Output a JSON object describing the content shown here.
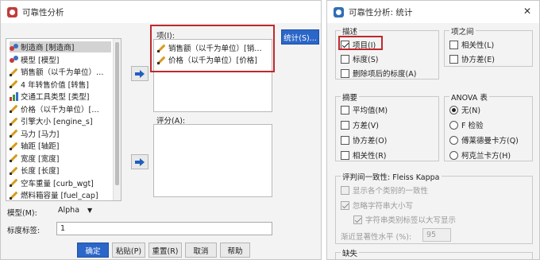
{
  "left_dialog": {
    "title": "可靠性分析",
    "variables": [
      {
        "label": "制造商 [制造商]",
        "icon": "nominal-icon"
      },
      {
        "label": "模型 [模型]",
        "icon": "nominal-icon"
      },
      {
        "label": "销售额（以千为单位）…",
        "icon": "scale-icon"
      },
      {
        "label": "4 年转售价值 [转售]",
        "icon": "scale-icon"
      },
      {
        "label": "交通工具类型 [类型]",
        "icon": "ordinal-icon"
      },
      {
        "label": "价格（以千为单位）[…",
        "icon": "scale-icon"
      },
      {
        "label": "引擎大小 [engine_s]",
        "icon": "scale-icon"
      },
      {
        "label": "马力 [马力]",
        "icon": "scale-icon"
      },
      {
        "label": "轴距 [轴距]",
        "icon": "scale-icon"
      },
      {
        "label": "宽度 [宽度]",
        "icon": "scale-icon"
      },
      {
        "label": "长度 [长度]",
        "icon": "scale-icon"
      },
      {
        "label": "空车重量 [curb_wgt]",
        "icon": "scale-icon"
      },
      {
        "label": "燃料箱容量 [fuel_cap]",
        "icon": "scale-icon"
      }
    ],
    "items_label": "项(I):",
    "items": [
      "销售额（以千为单位）[销…",
      "价格（以千为单位）[价格]"
    ],
    "raters_label": "评分(A):",
    "stats_button": "统计(S)...",
    "model_label": "模型(M):",
    "model_value": "Alpha",
    "scale_label_label": "标度标签:",
    "scale_label_value": "1",
    "buttons": {
      "ok": "确定",
      "paste": "粘贴(P)",
      "reset": "重置(R)",
      "cancel": "取消",
      "help": "帮助"
    }
  },
  "right_dialog": {
    "title": "可靠性分析: 统计",
    "descriptives": {
      "title": "描述",
      "options": [
        {
          "label": "项目(I)",
          "checked": true
        },
        {
          "label": "标度(S)",
          "checked": false
        },
        {
          "label": "删除项后的标度(A)",
          "checked": false
        }
      ]
    },
    "inter_item": {
      "title": "项之间",
      "options": [
        {
          "label": "相关性(L)",
          "checked": false
        },
        {
          "label": "协方差(E)",
          "checked": false
        }
      ]
    },
    "summaries": {
      "title": "摘要",
      "options": [
        {
          "label": "平均值(M)",
          "checked": false
        },
        {
          "label": "方差(V)",
          "checked": false
        },
        {
          "label": "协方差(O)",
          "checked": false
        },
        {
          "label": "相关性(R)",
          "checked": false
        }
      ]
    },
    "anova": {
      "title": "ANOVA 表",
      "options": [
        {
          "label": "无(N)",
          "selected": true
        },
        {
          "label": "F 检验",
          "selected": false
        },
        {
          "label": "傅莱德曼卡方(Q)",
          "selected": false
        },
        {
          "label": "柯克兰卡方(H)",
          "selected": false
        }
      ]
    },
    "fleiss": {
      "title": "评判间一致性: Fleiss Kappa",
      "options": [
        {
          "label": "显示各个类别的一致性",
          "checked": false
        },
        {
          "label": "忽略字符串大小写",
          "checked": true
        },
        {
          "label": "字符串类别标签以大写显示",
          "checked": true
        }
      ],
      "asymptotic_label": "渐近显著性水平 (%):",
      "asymptotic_value": "95"
    },
    "missing_title": "缺失"
  },
  "colors": {
    "accent": "#2b66c9",
    "highlight": "#c0282d"
  }
}
